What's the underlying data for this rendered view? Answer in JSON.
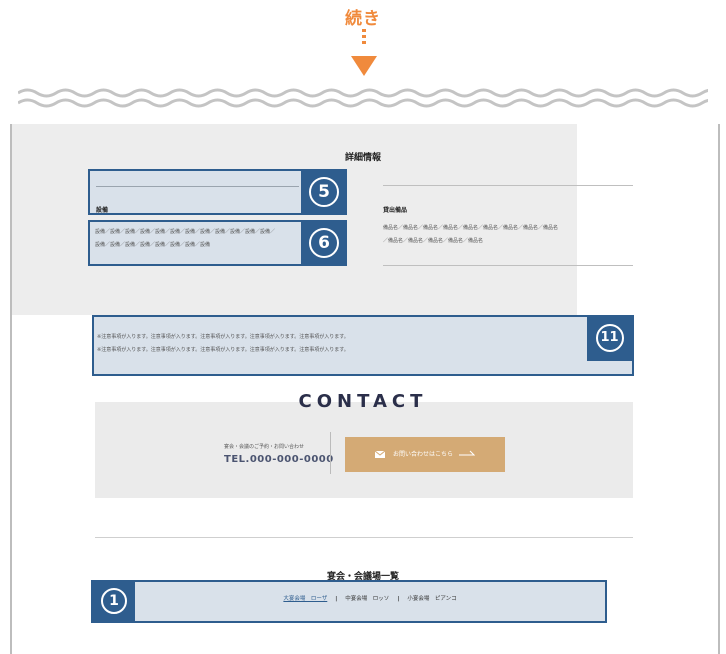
{
  "header": {
    "continuation_label": "続き",
    "accent_color": "#f08a3c"
  },
  "details": {
    "title": "詳細情報",
    "equipment_label": "設備",
    "equipment_items": [
      "設備／設備／設備／設備／設備／設備／設備／設備／設備／設備／設備／設備／",
      "設備／設備／設備／設備／設備／設備／設備／設備"
    ],
    "rental_label": "貸出備品",
    "rental_items": [
      "備品名／備品名／備品名／備品名／備品名／備品名／備品名／備品名／備品名",
      "／備品名／備品名／備品名／備品名／備品名"
    ]
  },
  "badges": {
    "b5": "5",
    "b6": "6",
    "b11": "11",
    "b1": "1",
    "color": "#2e5d8e"
  },
  "notes": [
    "※注意事項が入ります。注意事項が入ります。注意事項が入ります。注意事項が入ります。注意事項が入ります。",
    "※注意事項が入ります。注意事項が入ります。注意事項が入ります。注意事項が入ります。注意事項が入ります。"
  ],
  "contact": {
    "title": "CONTACT",
    "subtitle": "宴会・会議のご予約・お問い合わせ",
    "tel": "TEL.000-000-0000",
    "button_label": "お問い合わせはこちら",
    "button_color": "#d4aa75"
  },
  "venues": {
    "title": "宴会・会議場一覧",
    "items": [
      "大宴会場　ローザ",
      "中宴会場　ロッソ",
      "小宴会場　ピアンコ"
    ]
  }
}
